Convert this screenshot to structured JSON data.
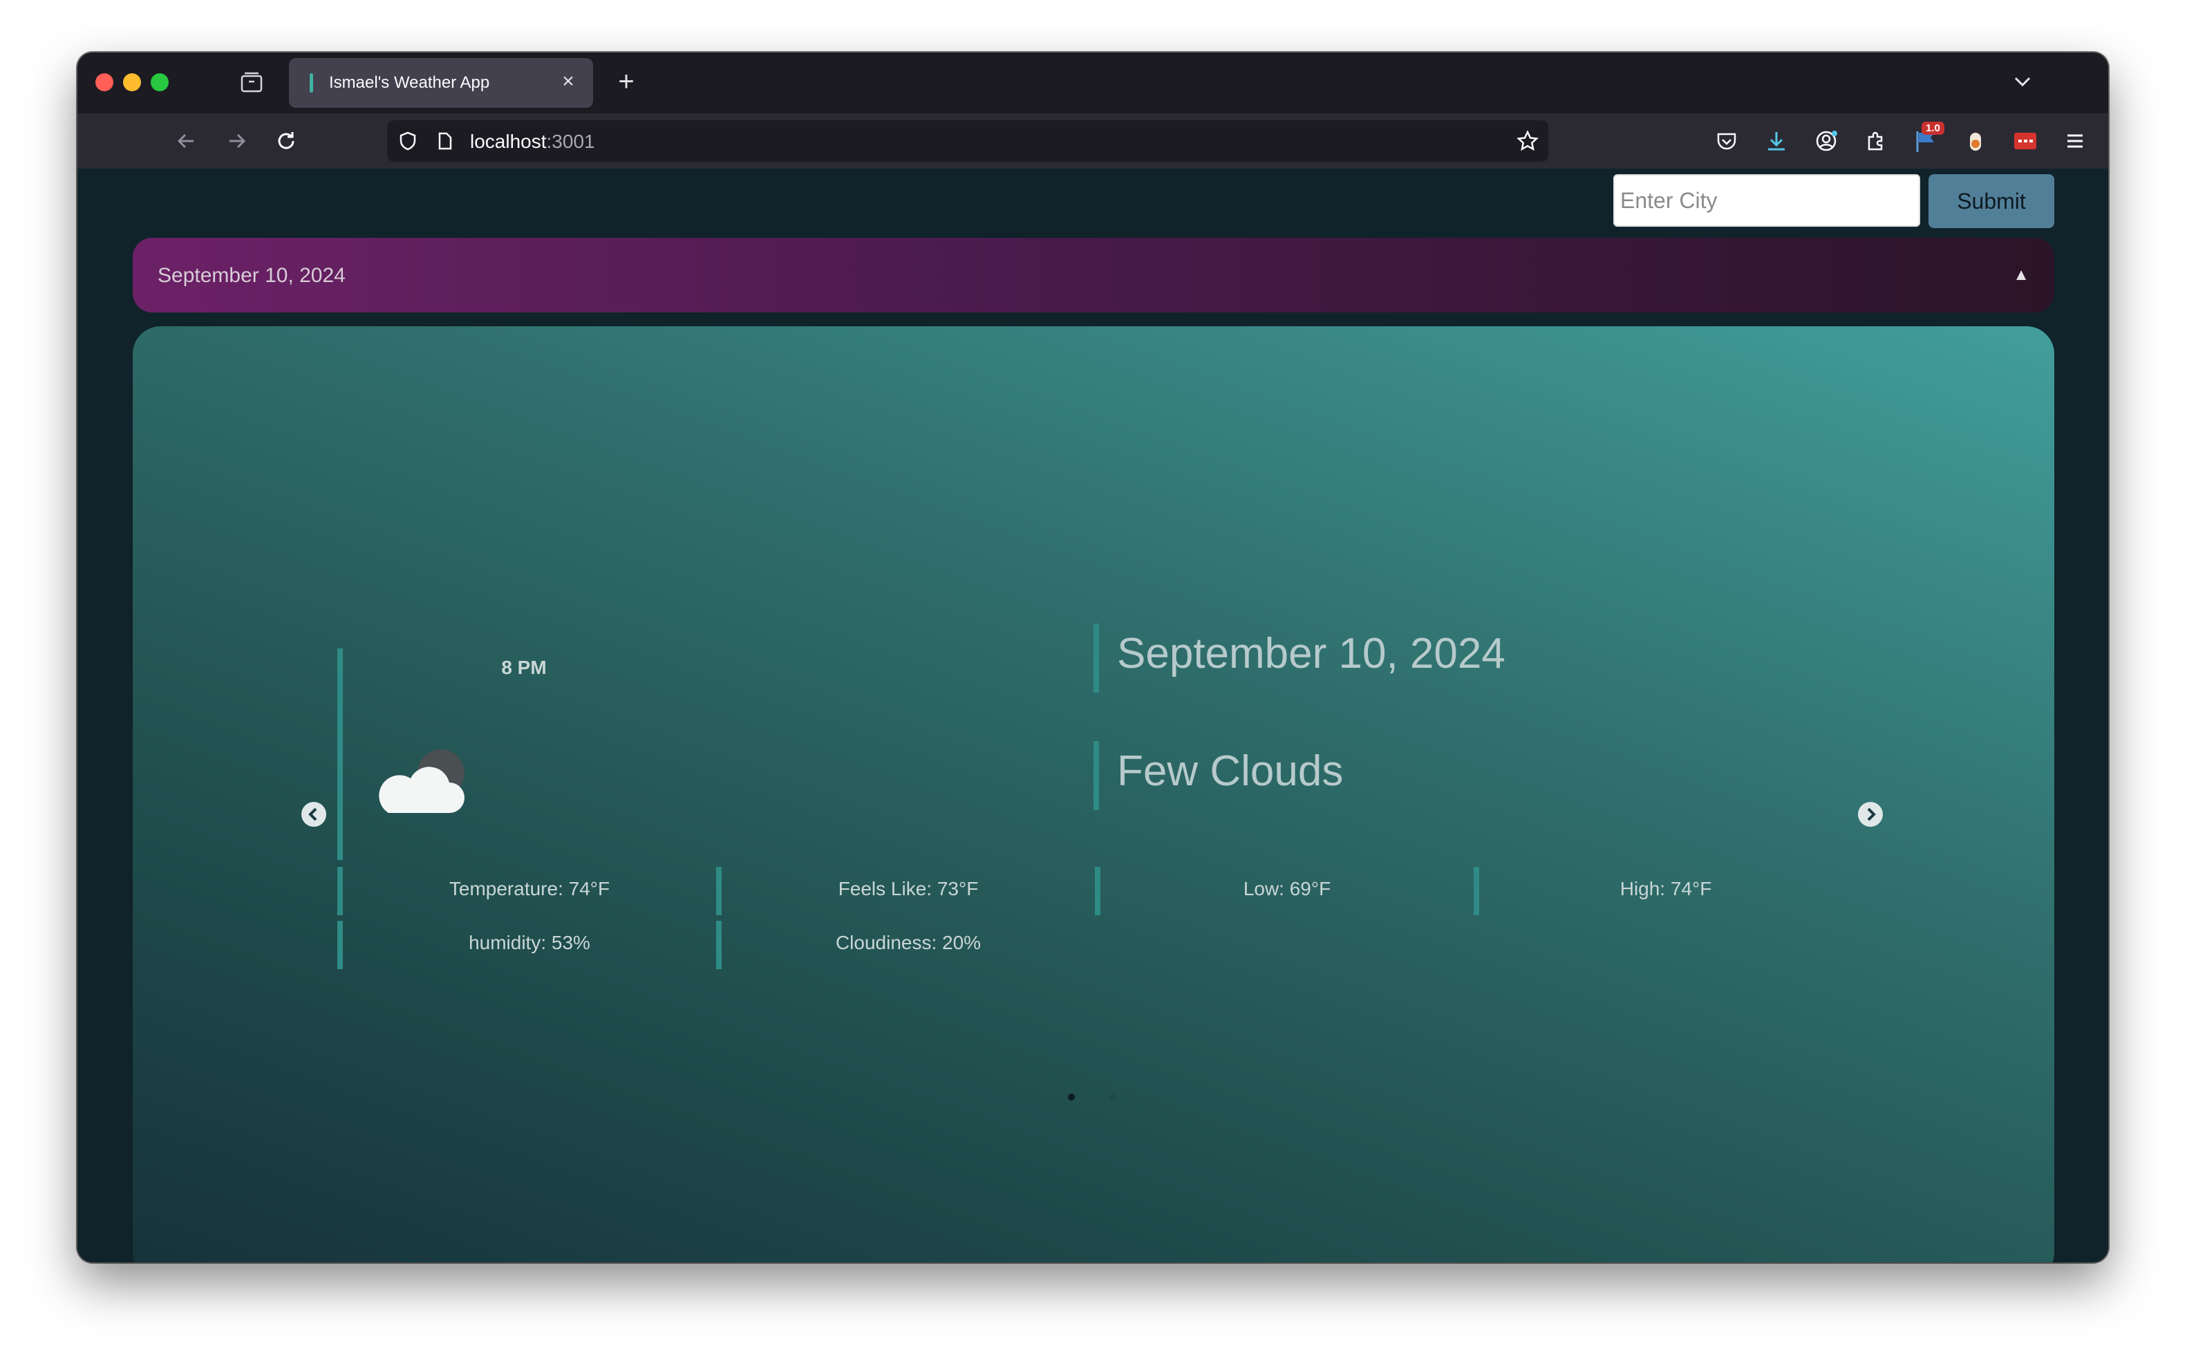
{
  "browser": {
    "tab_title": "Ismael's Weather App",
    "url_host": "localhost",
    "url_port": ":3001",
    "extension_badge": "1.0"
  },
  "search": {
    "placeholder": "Enter City",
    "submit_label": "Submit"
  },
  "accordion": {
    "date_label": "September 10, 2024",
    "toggle_glyph": "▲"
  },
  "forecast": {
    "time": "8 PM",
    "date": "September 10, 2024",
    "condition": "Few Clouds",
    "icon": "few-clouds-night-icon",
    "stats": {
      "temperature": "Temperature: 74°F",
      "feels_like": "Feels Like: 73°F",
      "low": "Low: 69°F",
      "high": "High: 74°F",
      "humidity": "humidity: 53%",
      "cloudiness": "Cloudiness: 20%"
    }
  },
  "carousel": {
    "active_slide": 1,
    "slide_count": 2
  },
  "colors": {
    "accordion_start": "#6c2167",
    "panel_light": "#429e9c",
    "panel_dark": "#16323a",
    "accent_bar": "#2f8b86",
    "submit_button": "#527f98"
  }
}
